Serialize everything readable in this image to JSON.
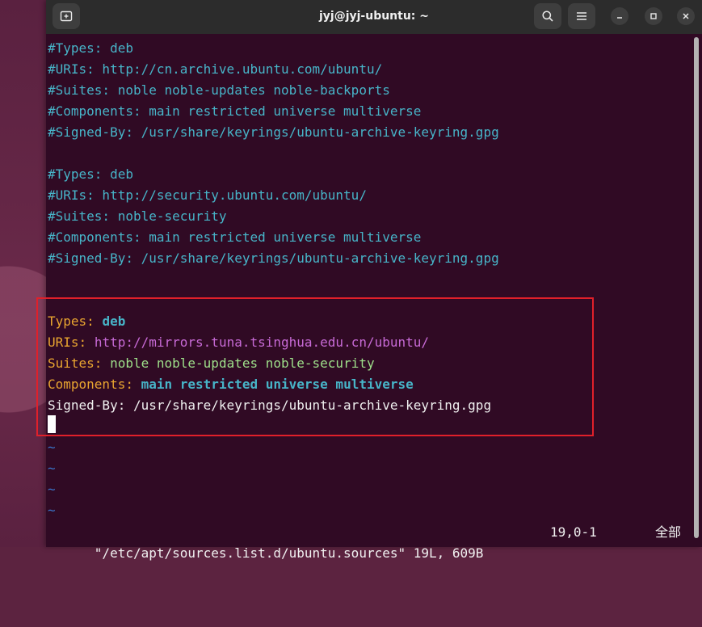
{
  "window": {
    "title": "jyj@jyj-ubuntu: ~"
  },
  "terminal": {
    "comment_block_1": [
      "#Types: deb",
      "#URIs: http://cn.archive.ubuntu.com/ubuntu/",
      "#Suites: noble noble-updates noble-backports",
      "#Components: main restricted universe multiverse",
      "#Signed-By: /usr/share/keyrings/ubuntu-archive-keyring.gpg"
    ],
    "comment_block_2": [
      "#Types: deb",
      "#URIs: http://security.ubuntu.com/ubuntu/",
      "#Suites: noble-security",
      "#Components: main restricted universe multiverse",
      "#Signed-By: /usr/share/keyrings/ubuntu-archive-keyring.gpg"
    ],
    "active_block": {
      "types_key": "Types:",
      "types_value": "deb",
      "uris_key": "URIs:",
      "uris_value": "http://mirrors.tuna.tsinghua.edu.cn/ubuntu/",
      "suites_key": "Suites:",
      "suites_value": "noble noble-updates noble-security",
      "components_key": "Components:",
      "components_value": "main restricted universe multiverse",
      "signed_by_line": "Signed-By: /usr/share/keyrings/ubuntu-archive-keyring.gpg"
    },
    "empty_marker": "~",
    "status": {
      "file_info": "\"/etc/apt/sources.list.d/ubuntu.sources\" 19L, 609B",
      "position": "19,0-1",
      "scroll_indicator": "全部"
    }
  },
  "colors": {
    "terminal_bg": "#300a24",
    "comment": "#47b4c8",
    "key": "#e9a530",
    "url": "#c76ad6",
    "suite_value": "#9ee08a",
    "highlight_border": "#e0202a",
    "tilde": "#3a74c9"
  },
  "icons": {
    "new_tab": "new-tab-icon",
    "search": "search-icon",
    "menu": "hamburger-menu-icon",
    "minimize": "minimize-icon",
    "maximize": "maximize-icon",
    "close": "close-icon"
  }
}
